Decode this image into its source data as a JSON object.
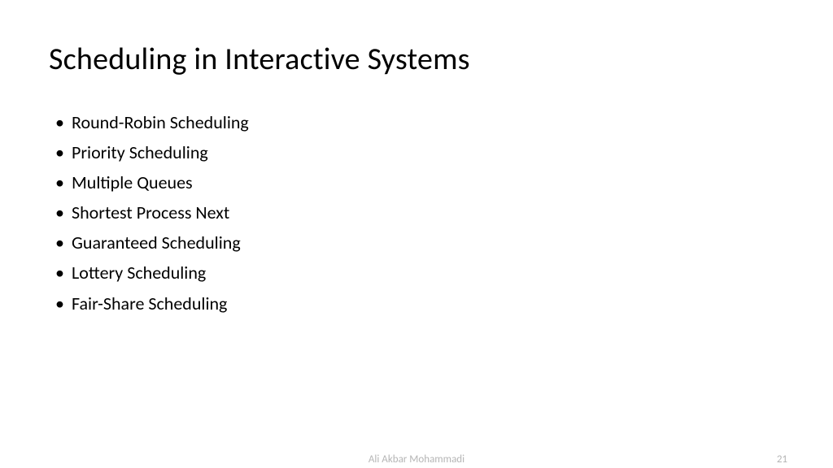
{
  "title": "Scheduling in Interactive Systems",
  "bullets": [
    "Round-Robin Scheduling",
    "Priority Scheduling",
    "Multiple Queues",
    "Shortest Process Next",
    "Guaranteed Scheduling",
    "Lottery Scheduling",
    "Fair-Share Scheduling"
  ],
  "footer": {
    "author": "Ali Akbar Mohammadi",
    "page": "21"
  }
}
